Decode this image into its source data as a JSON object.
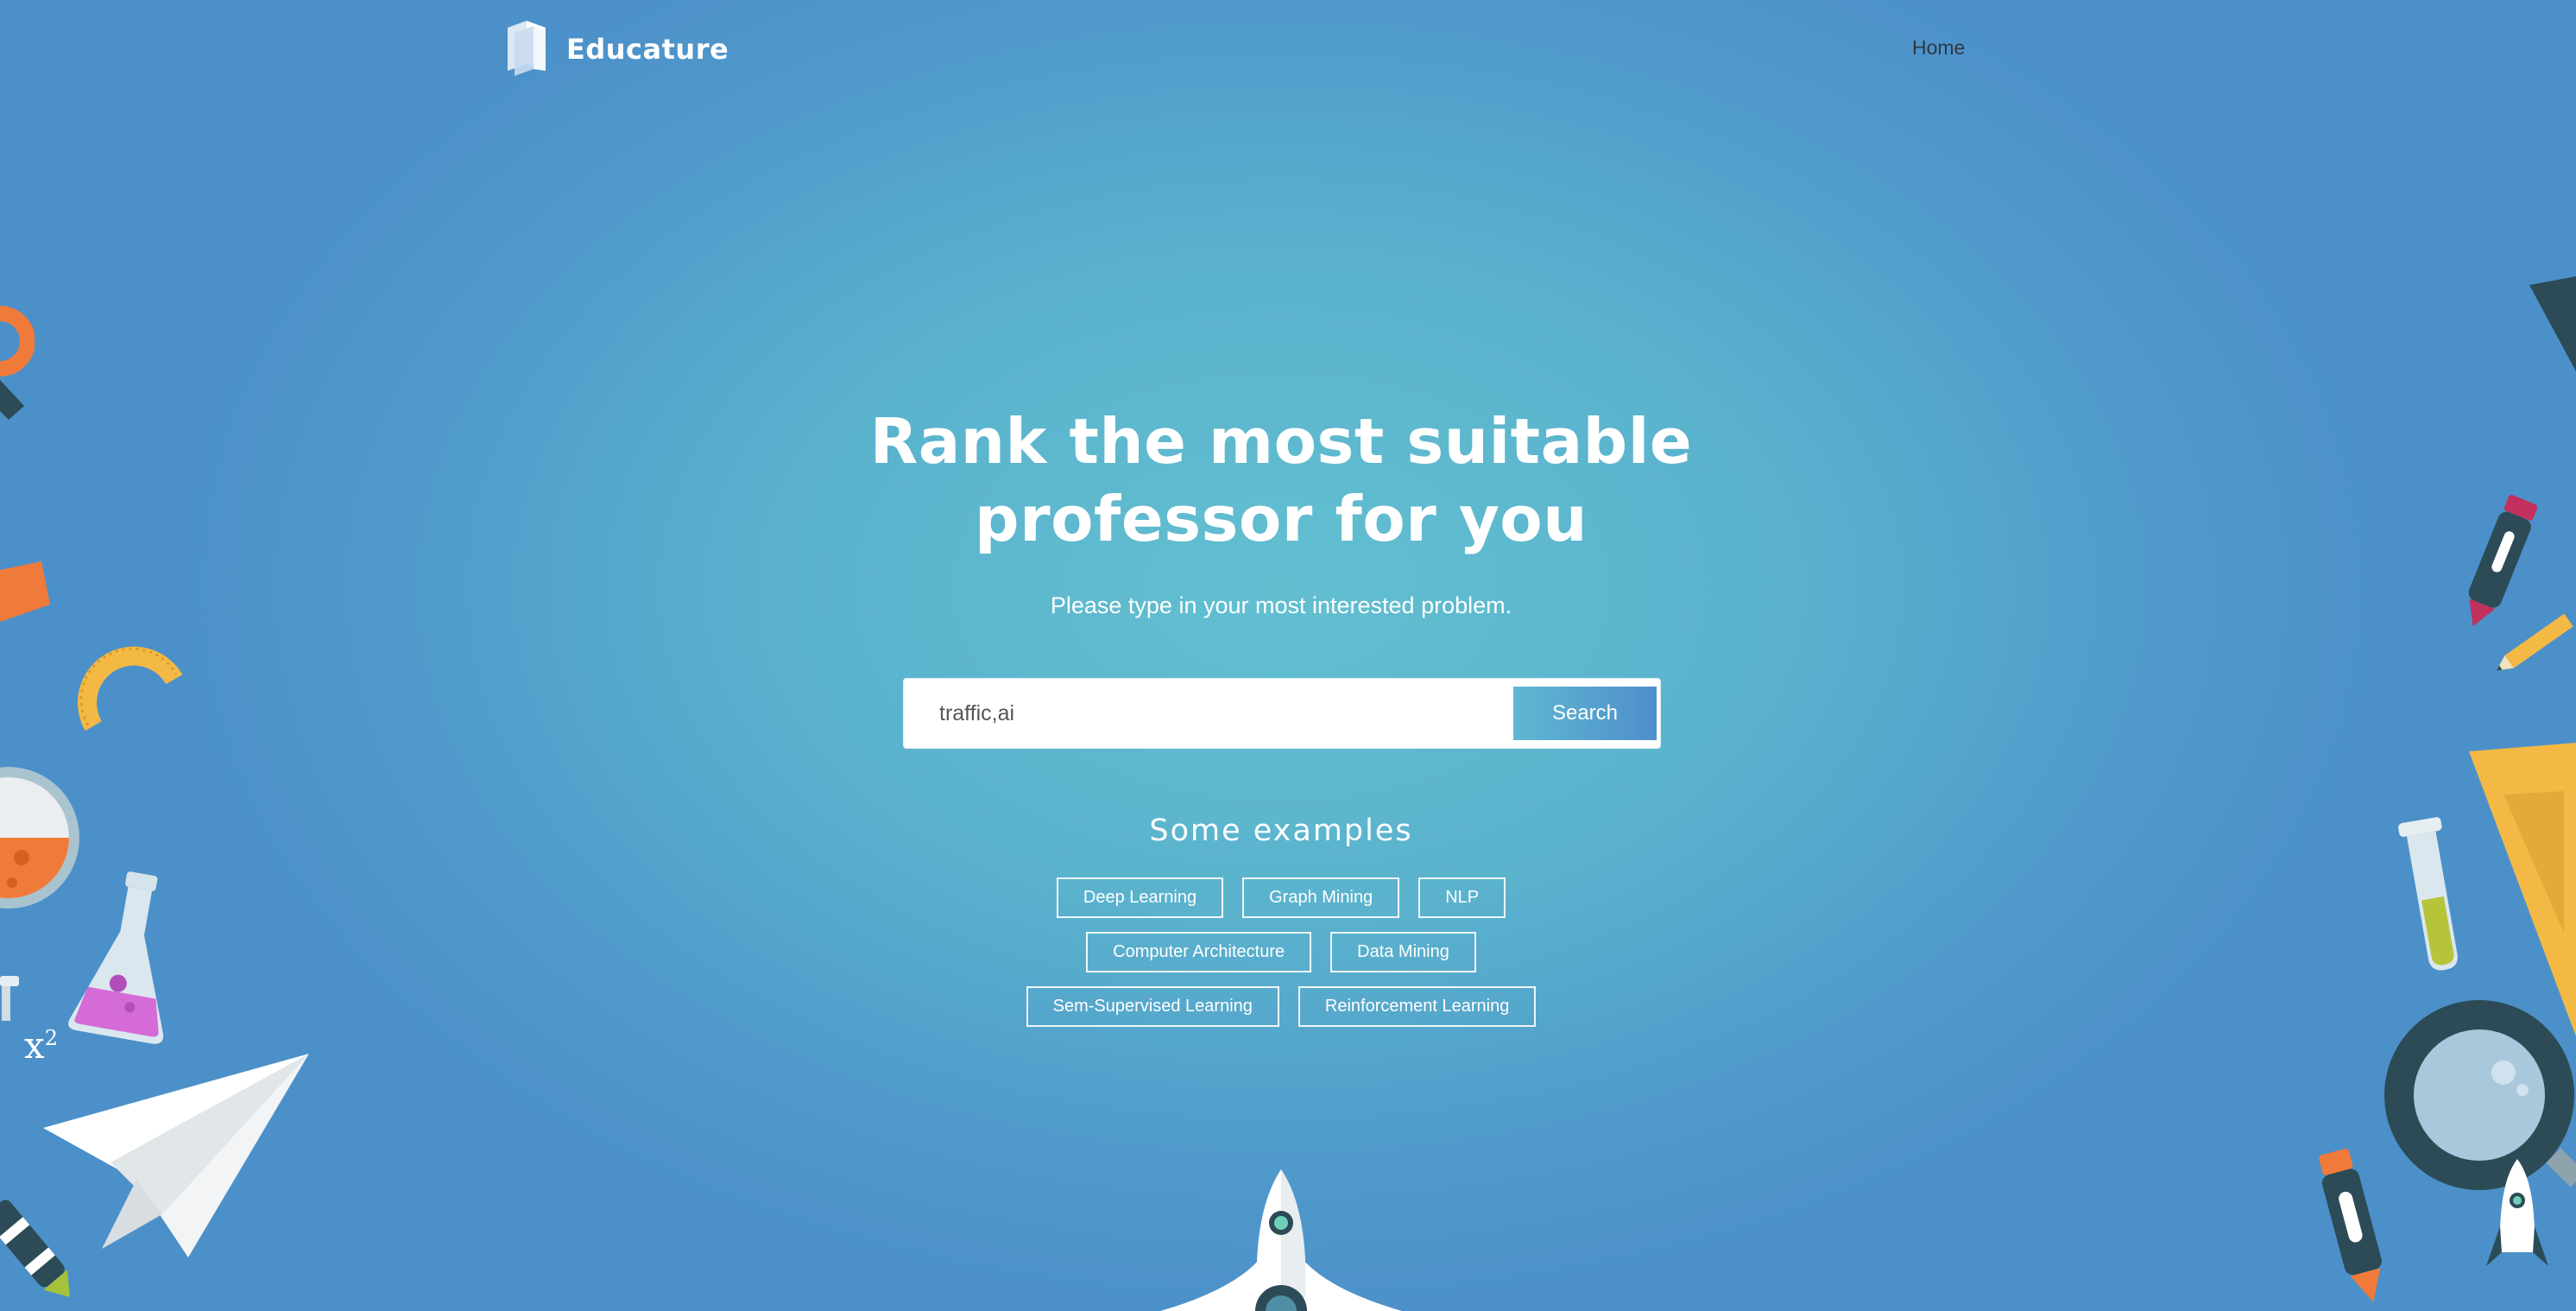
{
  "header": {
    "brand": "Educature",
    "nav": {
      "home": "Home"
    }
  },
  "hero": {
    "title_line1": "Rank the most suitable",
    "title_line2": "professor for you",
    "subtitle": "Please type in your most interested problem."
  },
  "search": {
    "value": "traffic,ai",
    "button_label": "Search"
  },
  "examples": {
    "heading": "Some examples",
    "row1": [
      "Deep Learning",
      "Graph Mining",
      "NLP"
    ],
    "row2": [
      "Computer Architecture",
      "Data Mining"
    ],
    "row3": [
      "Sem-Supervised Learning",
      "Reinforcement Learning"
    ]
  },
  "decorations": {
    "icons": [
      "logo-book-icon",
      "magnifier-icon",
      "protractor-icon",
      "flask-icon",
      "paper-plane-icon",
      "crayon-icon",
      "pencil-icon",
      "test-tube-icon",
      "set-square-icon",
      "rocket-icon",
      "x-squared-icon"
    ],
    "formula": "x",
    "formula_exponent": "2"
  },
  "colors": {
    "accent_start": "#5fb8d2",
    "accent_end": "#4f8fcb",
    "background_center": "#62bfd0",
    "background_edge": "#4c90c9"
  }
}
